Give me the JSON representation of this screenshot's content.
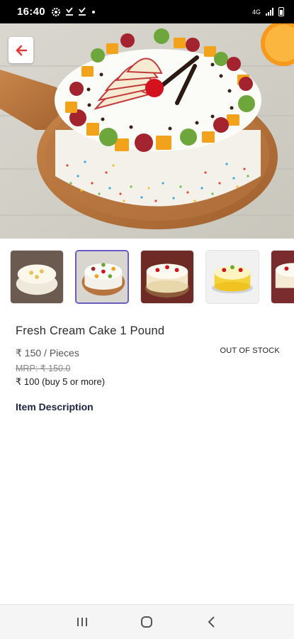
{
  "status_bar": {
    "time": "16:40",
    "left_icons": [
      "settings-icon",
      "download-icon",
      "download-icon",
      "dot-icon"
    ],
    "network": "4G",
    "right_icons": [
      "signal-icon",
      "battery-icon"
    ]
  },
  "product": {
    "name": "Fresh Cream Cake 1 Pound",
    "price": "₹ 150 / Pieces",
    "mrp": "MRP: ₹ 150.0",
    "bulk_offer": "₹ 100 (buy 5 or more)",
    "stock_status": "OUT OF STOCK"
  },
  "gallery": {
    "selected_index": 1,
    "thumbnails": [
      "thumbnail-1",
      "thumbnail-2",
      "thumbnail-3",
      "thumbnail-4",
      "thumbnail-5"
    ]
  },
  "description": {
    "heading": "Item Description"
  },
  "colors": {
    "accent": "#6b5cc7",
    "back_arrow": "#e53935",
    "heading": "#1d2345"
  }
}
